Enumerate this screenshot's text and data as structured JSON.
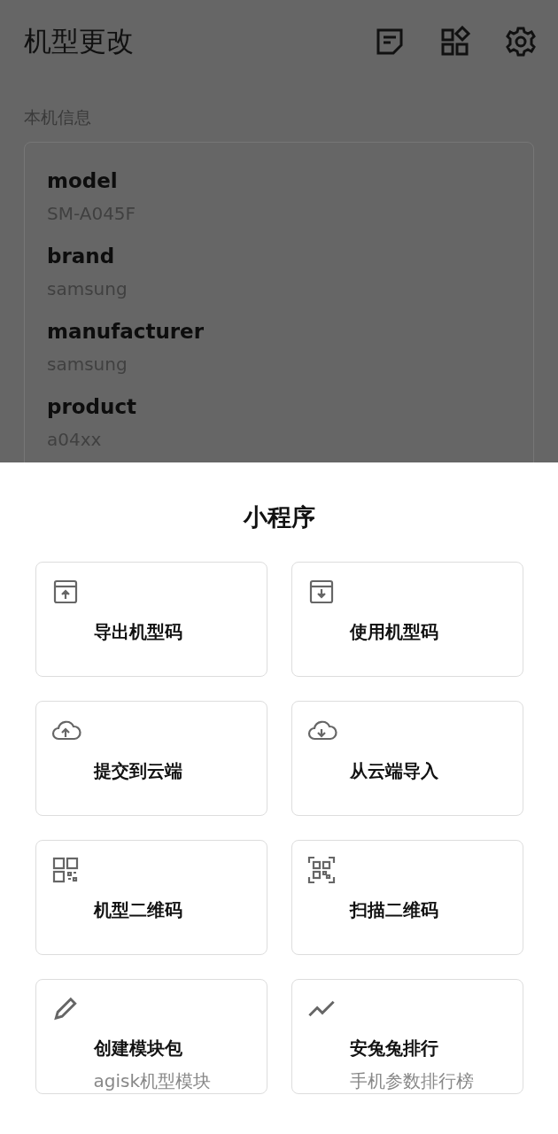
{
  "app_bar": {
    "title": "机型更改"
  },
  "section_label": "本机信息",
  "device_info": [
    {
      "key": "model",
      "value": "SM-A045F"
    },
    {
      "key": "brand",
      "value": "samsung"
    },
    {
      "key": "manufacturer",
      "value": "samsung"
    },
    {
      "key": "product",
      "value": "a04xx"
    }
  ],
  "sheet": {
    "title": "小程序",
    "items": [
      {
        "title": "导出机型码"
      },
      {
        "title": "使用机型码"
      },
      {
        "title": "提交到云端"
      },
      {
        "title": "从云端导入"
      },
      {
        "title": "机型二维码"
      },
      {
        "title": "扫描二维码"
      },
      {
        "title": "创建模块包",
        "subtitle": "agisk机型模块"
      },
      {
        "title": "安兔兔排行",
        "subtitle": "手机参数排行榜"
      }
    ]
  }
}
